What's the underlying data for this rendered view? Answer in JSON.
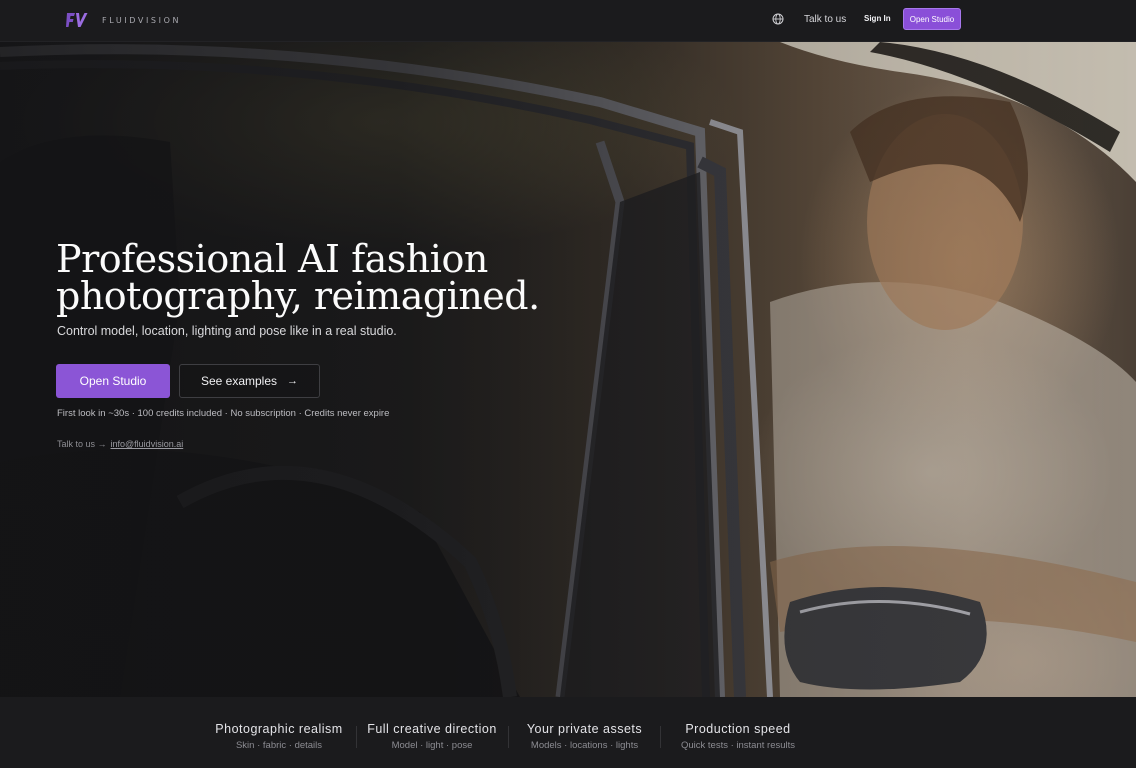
{
  "nav": {
    "brand": "FLUIDVISION",
    "talk_label": "Talk to us",
    "signin_label": "Sign In",
    "cta_label": "Open Studio"
  },
  "hero": {
    "headline": "Professional AI fashion photography, reimagined.",
    "subline": "Control model, location, lighting and pose like in a real studio.",
    "primary_cta": "Open Studio",
    "secondary_cta": "See examples",
    "meta": "First look in ~30s · 100 credits included · No subscription · Credits never expire",
    "contact_prefix": "Talk to us →",
    "contact_email": "info@fluidvision.ai"
  },
  "features": [
    {
      "title": "Photographic realism",
      "sub": "Skin · fabric · details"
    },
    {
      "title": "Full creative direction",
      "sub": "Model · light · pose"
    },
    {
      "title": "Your private assets",
      "sub": "Models · locations · lights"
    },
    {
      "title": "Production speed",
      "sub": "Quick tests · instant results"
    }
  ],
  "colors": {
    "accent": "#8b55d6",
    "background": "#161617"
  },
  "icons": {
    "logo": "fv-logo-icon",
    "language": "globe-icon",
    "see_examples": "arrow-right-icon"
  }
}
